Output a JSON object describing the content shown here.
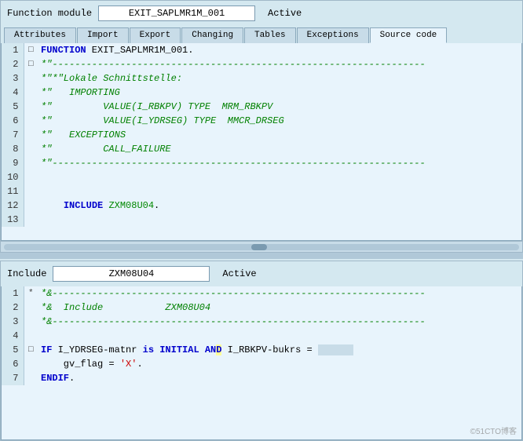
{
  "top_panel": {
    "header": {
      "label": "Function module",
      "value": "EXIT_SAPLMR1M_001",
      "status": "Active"
    },
    "tabs": [
      {
        "label": "Attributes",
        "active": false
      },
      {
        "label": "Import",
        "active": false
      },
      {
        "label": "Export",
        "active": false
      },
      {
        "label": "Changing",
        "active": false
      },
      {
        "label": "Tables",
        "active": false
      },
      {
        "label": "Exceptions",
        "active": false
      },
      {
        "label": "Source code",
        "active": true
      }
    ],
    "lines": [
      {
        "num": 1,
        "marker": "□",
        "code": "FUNCTION EXIT_SAPLMR1M_001.",
        "type": "keyword"
      },
      {
        "num": 2,
        "marker": "□",
        "code": "*\"------------------------------------------------------------------",
        "type": "comment"
      },
      {
        "num": 3,
        "marker": "",
        "code": "*\"*\"Lokale Schnittstelle:",
        "type": "comment"
      },
      {
        "num": 4,
        "marker": "",
        "code": "*\"   IMPORTING",
        "type": "comment"
      },
      {
        "num": 5,
        "marker": "",
        "code": "*\"         VALUE(I_RBKPV) TYPE  MRM_RBKPV",
        "type": "comment"
      },
      {
        "num": 6,
        "marker": "",
        "code": "*\"         VALUE(I_YDRSEG) TYPE  MMCR_DRSEG",
        "type": "comment"
      },
      {
        "num": 7,
        "marker": "",
        "code": "*\"   EXCEPTIONS",
        "type": "comment"
      },
      {
        "num": 8,
        "marker": "",
        "code": "*\"         CALL_FAILURE",
        "type": "comment"
      },
      {
        "num": 9,
        "marker": "",
        "code": "*\"------------------------------------------------------------------",
        "type": "comment"
      },
      {
        "num": 10,
        "marker": "",
        "code": "",
        "type": "empty"
      },
      {
        "num": 11,
        "marker": "",
        "code": "",
        "type": "empty"
      },
      {
        "num": 12,
        "marker": "",
        "code": "    INCLUDE ZXM08U04.",
        "type": "include"
      },
      {
        "num": 13,
        "marker": "",
        "code": "",
        "type": "empty"
      }
    ]
  },
  "bottom_panel": {
    "header": {
      "label": "Include",
      "value": "ZXM08U04",
      "status": "Active"
    },
    "lines": [
      {
        "num": 1,
        "marker": "*",
        "code": "*&------------------------------------------------------------------",
        "type": "comment"
      },
      {
        "num": 2,
        "marker": "",
        "code": "*&  Include           ZXM08U04",
        "type": "comment"
      },
      {
        "num": 3,
        "marker": "",
        "code": "*&------------------------------------------------------------------",
        "type": "comment"
      },
      {
        "num": 4,
        "marker": "",
        "code": "",
        "type": "empty"
      },
      {
        "num": 5,
        "marker": "□",
        "code": "IF I_YDRSEG-matnr is INITIAL AND I_RBKPV-bukrs =",
        "type": "if_line"
      },
      {
        "num": 6,
        "marker": "",
        "code": "    gv_flag = 'X'.",
        "type": "assign"
      },
      {
        "num": 7,
        "marker": "",
        "code": "ENDIF.",
        "type": "keyword"
      }
    ]
  },
  "watermark": "©51CTO博客"
}
